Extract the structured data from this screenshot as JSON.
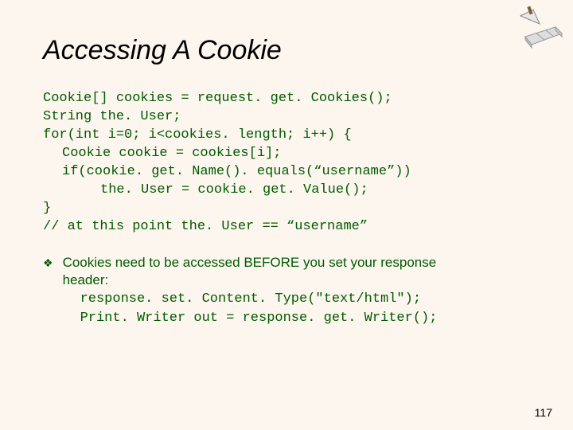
{
  "title": "Accessing A Cookie",
  "code": {
    "l1": "Cookie[] cookies = request. get. Cookies();",
    "l2": "String the. User;",
    "l3": "for(int i=0; i<cookies. length; i++) {",
    "l4": "Cookie cookie = cookies[i];",
    "l5": "if(cookie. get. Name(). equals(“username”))",
    "l6": "the. User = cookie. get. Value();",
    "l7": "}",
    "l8": "// at this point the. User == “username”"
  },
  "bullet": {
    "mark": "❖",
    "text_line1": "Cookies need to be accessed BEFORE you set your response",
    "text_line2": "header:",
    "code_line1": "response. set. Content. Type(\"text/html\");",
    "code_line2": "Print. Writer out = response. get. Writer();"
  },
  "page_number": "117"
}
